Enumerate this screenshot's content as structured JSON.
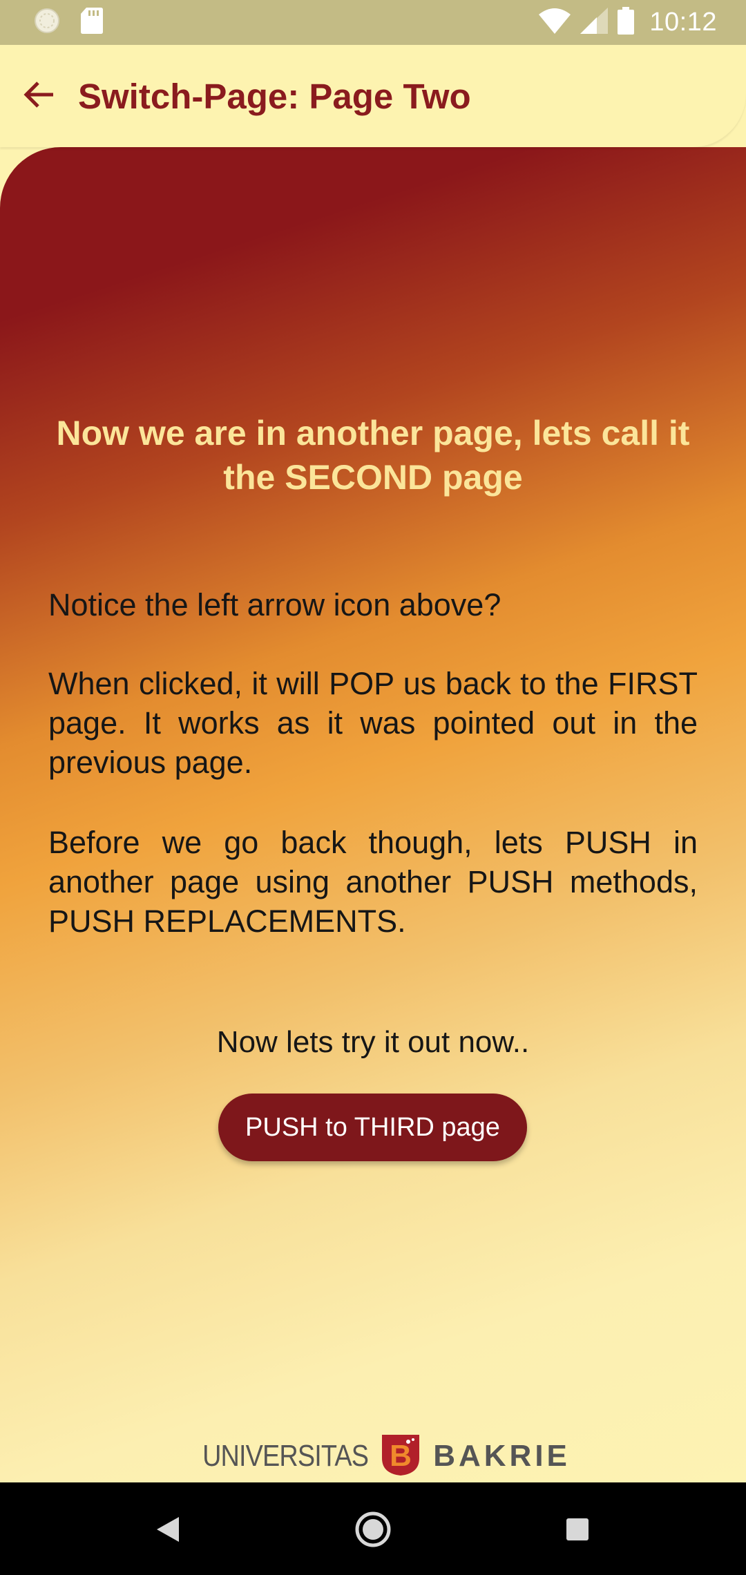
{
  "status_bar": {
    "time": "10:12",
    "icons": [
      "sync-icon",
      "sd-card-icon",
      "wifi-icon",
      "signal-icon",
      "battery-icon"
    ]
  },
  "app_bar": {
    "back_icon": "arrow-back-icon",
    "title": "Switch-Page: Page Two"
  },
  "main": {
    "heading": "Now we are in another page, lets call it the SECOND page",
    "paragraphs": [
      "Notice the left arrow icon above?",
      "When clicked, it will POP us back to the FIRST page. It works as it was pointed out in the previous page.",
      "Before we go back though, lets PUSH in another page using another PUSH methods, PUSH REPLACEMENTS."
    ],
    "try_text": "Now lets try it out now..",
    "push_button_label": "PUSH to THIRD page"
  },
  "logo": {
    "left_text": "UNIVERSITAS",
    "right_text": "BAKRIE",
    "emblem_letter": "B"
  },
  "nav_bar": {
    "icons": [
      "back-triangle-icon",
      "home-circle-icon",
      "recents-square-icon"
    ]
  },
  "colors": {
    "accent": "#8a1b1e",
    "app_bar_bg": "#fdf3b0",
    "status_bar_bg": "#c3bb85",
    "gradient_top": "#8b171a",
    "gradient_mid": "#e38c2f",
    "gradient_bottom": "#fdf3b3",
    "heading_text": "#fbe59a",
    "button_bg": "#7e171b"
  }
}
